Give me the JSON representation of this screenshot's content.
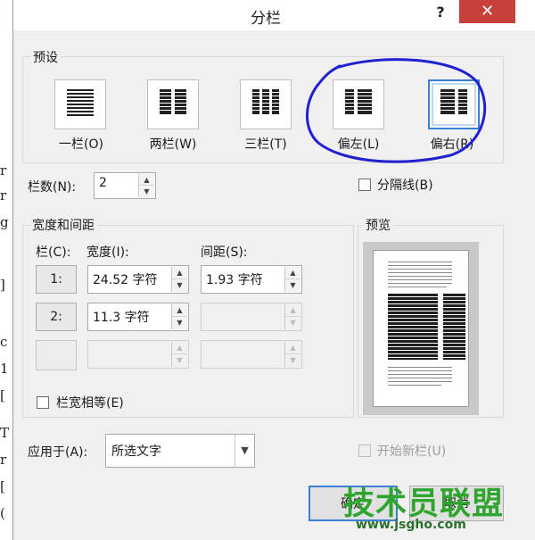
{
  "document_background": {
    "chars": [
      "r",
      "r",
      "g",
      "]",
      "c",
      "1",
      "[",
      "",
      "T",
      "r",
      "[",
      "("
    ]
  },
  "dialog": {
    "title": "分栏",
    "help": "?",
    "close": "✕"
  },
  "presets": {
    "group_label": "预设",
    "items": [
      {
        "label": "一栏(O)",
        "icon": "one-column-icon"
      },
      {
        "label": "两栏(W)",
        "icon": "two-columns-icon"
      },
      {
        "label": "三栏(T)",
        "icon": "three-columns-icon"
      },
      {
        "label": "偏左(L)",
        "icon": "left-column-icon"
      },
      {
        "label": "偏右(R)",
        "icon": "right-column-icon",
        "selected": true
      }
    ]
  },
  "column_count": {
    "label": "栏数(N):",
    "value": "2"
  },
  "line_between": {
    "label": "分隔线(B)",
    "checked": false
  },
  "width_spacing": {
    "group_label": "宽度和间距",
    "col_header": "栏(C):",
    "width_header": "宽度(I):",
    "spacing_header": "间距(S):",
    "rows": [
      {
        "num": "1:",
        "width": "24.52 字符",
        "spacing": "1.93 字符",
        "enabled": true
      },
      {
        "num": "2:",
        "width": "11.3 字符",
        "spacing": "",
        "enabled": true,
        "spacing_enabled": false
      },
      {
        "num": "",
        "width": "",
        "spacing": "",
        "enabled": false
      }
    ]
  },
  "equal_width": {
    "label": "栏宽相等(E)",
    "checked": false
  },
  "preview": {
    "label": "预览"
  },
  "apply_to": {
    "label": "应用于(A):",
    "value": "所选文字"
  },
  "new_column": {
    "label": "开始新栏(U)",
    "checked": false,
    "enabled": false
  },
  "buttons": {
    "ok": "确定",
    "cancel": "取消"
  },
  "watermark": {
    "title": "技术员联盟",
    "url": "www.jsgho.com"
  },
  "colors": {
    "close": "#c7403a",
    "selection_outline": "#2020d0",
    "watermark": "#2fa42f"
  }
}
